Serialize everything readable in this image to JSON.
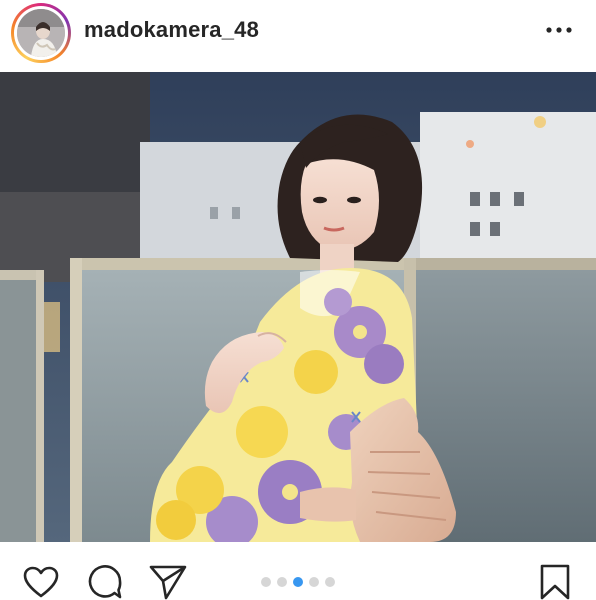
{
  "post": {
    "username": "madokamera_48",
    "carousel": {
      "total": 5,
      "active_index": 2
    }
  },
  "colors": {
    "text": "#262626",
    "carousel_active": "#3897f0",
    "carousel_inactive": "#d6d6d6"
  },
  "icons": {
    "more": "more-options-icon",
    "like": "heart-icon",
    "comment": "comment-bubble-icon",
    "share": "paper-plane-icon",
    "save": "bookmark-icon"
  }
}
